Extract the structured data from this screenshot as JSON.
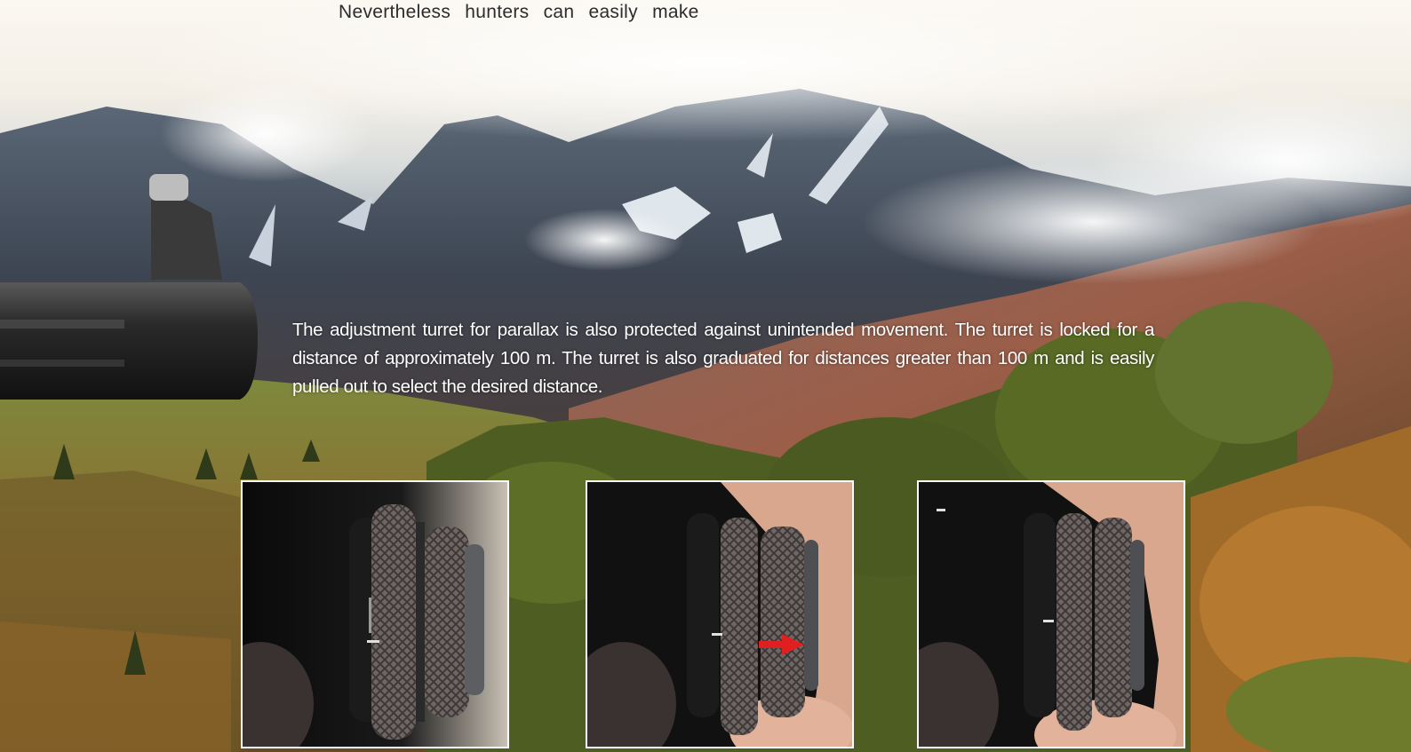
{
  "header": {
    "partial_line": "Nevertheless hunters can easily make"
  },
  "content": {
    "paragraph": "The adjustment turret for parallax is also protected against unintended movement. The turret is locked for a distance of approximately 100 m. The turret is also graduated for distances greater than 100 m and is easily pulled out to select the desired distance."
  },
  "photos": [
    {
      "state": "locked"
    },
    {
      "state": "pulled-out",
      "arrow_color": "#e02020"
    },
    {
      "state": "adjusting"
    }
  ]
}
